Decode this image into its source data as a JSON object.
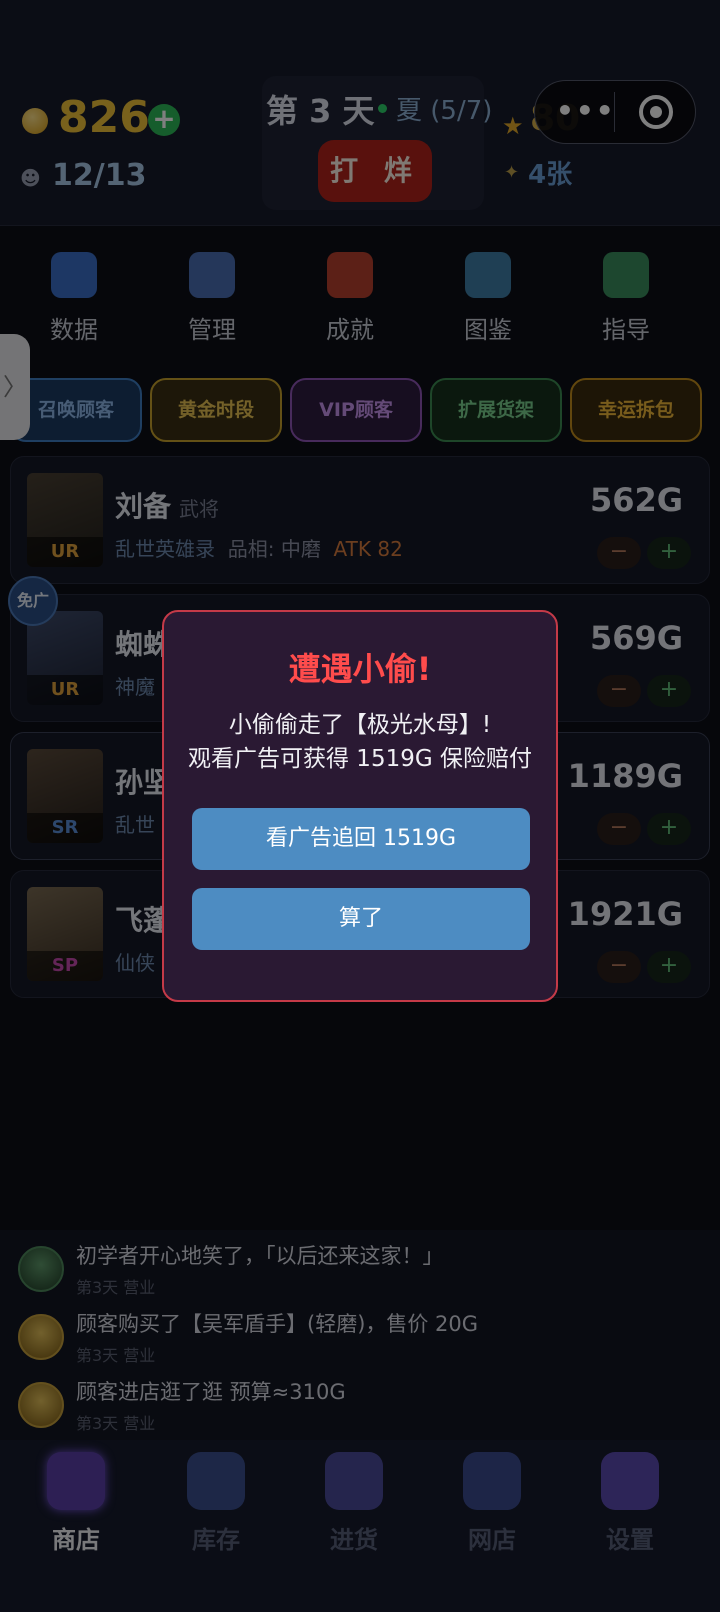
{
  "topbar": {
    "coins": "826",
    "coin_plus": "+",
    "staff": "12/13",
    "day": "第 3 天",
    "season": "夏 (5/7)",
    "close_shop": "打 烊",
    "reputation": "80",
    "cards": "4张"
  },
  "miniprogram": {
    "more": "•••"
  },
  "nav": [
    {
      "label": "数据",
      "icon": "bar-chart-icon",
      "color": "#3a6fc8"
    },
    {
      "label": "管理",
      "icon": "gear-document-icon",
      "color": "#4a6fb5"
    },
    {
      "label": "成就",
      "icon": "medal-icon",
      "color": "#b8412e"
    },
    {
      "label": "图鉴",
      "icon": "book-icon",
      "color": "#3f7fa8"
    },
    {
      "label": "指导",
      "icon": "guide-figure-icon",
      "color": "#3a8f5e"
    }
  ],
  "side_tab": "〉",
  "features": [
    {
      "label": "召唤顾客",
      "color": "#3f7fc4"
    },
    {
      "label": "黄金时段",
      "color": "#c8a22c"
    },
    {
      "label": "VIP顾客",
      "color": "#9056b8"
    },
    {
      "label": "扩展货架",
      "color": "#3d8d52"
    },
    {
      "label": "幸运拆包",
      "color": "#c48f1c"
    }
  ],
  "items": [
    {
      "name": "刘备",
      "type": "武将",
      "series": "乱世英雄录",
      "condition": "品相: 中磨",
      "atk": "ATK 82",
      "price": "562G",
      "rarity": "UR",
      "rarity_color": "#e0a23c"
    },
    {
      "name": "蜘蛛",
      "type": "",
      "series": "神魔",
      "condition": "",
      "atk": "",
      "price": "569G",
      "rarity": "UR",
      "rarity_color": "#e0a23c"
    },
    {
      "name": "孙坚",
      "type": "",
      "series": "乱世",
      "condition": "",
      "atk": "",
      "price": "1189G",
      "rarity": "SR",
      "rarity_color": "#5b8fd8"
    },
    {
      "name": "飞蓬",
      "type": "",
      "series": "仙侠",
      "condition": "",
      "atk": "",
      "price": "1921G",
      "rarity": "SP",
      "rarity_color": "#c94bb0"
    }
  ],
  "stepper": {
    "minus": "−",
    "plus": "+"
  },
  "ad_free_badge": "免广",
  "logs": [
    {
      "text": "初学者开心地笑了，「以后还来这家！」",
      "sub": "第3天 营业",
      "avatar": "green"
    },
    {
      "text": "顾客购买了【吴军盾手】(轻磨)，售价 20G",
      "sub": "第3天 营业",
      "avatar": "gold"
    },
    {
      "text": " 顾客进店逛了逛 预算≈310G",
      "sub": "第3天 营业",
      "avatar": "gold"
    }
  ],
  "tabs": [
    {
      "label": "商店",
      "icon": "shop-icon",
      "color": "#5a3fa8",
      "active": true
    },
    {
      "label": "库存",
      "icon": "cards-icon",
      "color": "#3a4e8f",
      "active": false
    },
    {
      "label": "进货",
      "icon": "box-icon",
      "color": "#4a4a9a",
      "active": false
    },
    {
      "label": "网店",
      "icon": "online-store-icon",
      "color": "#3a4a8f",
      "active": false
    },
    {
      "label": "设置",
      "icon": "gear-icon",
      "color": "#5a4ab0",
      "active": false
    }
  ],
  "modal": {
    "title": "遭遇小偷!",
    "line1": "小偷偷走了【极光水母】!",
    "line2": "观看广告可获得 1519G 保险赔付",
    "watch_ad": "看广告追回 1519G",
    "dismiss": "算了"
  }
}
